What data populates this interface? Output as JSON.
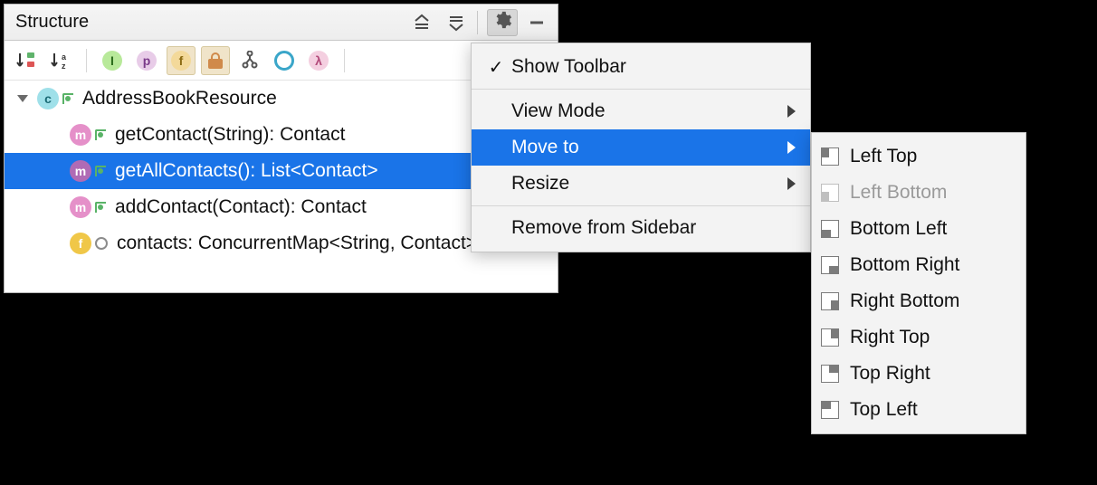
{
  "panel": {
    "title": "Structure",
    "header_buttons": {
      "expand_all": "expand-all",
      "collapse_all": "collapse-all",
      "settings": "settings",
      "hide": "hide"
    }
  },
  "toolbar": {
    "sort_by_visibility": "sort-by-visibility",
    "sort_alphabetically": "sort-alphabetically",
    "show_interfaces": "I",
    "show_properties": "p",
    "show_fields": "f",
    "show_non_public": "lock",
    "show_inherited": "inherited",
    "show_anonymous": "anonymous",
    "show_lambdas": "λ"
  },
  "tree": {
    "class_icon": "c",
    "class_name": "AddressBookResource",
    "members": [
      {
        "icon": "m",
        "iconColor": "#e590c9",
        "vis": "open",
        "text": "getContact(String): Contact",
        "selected": false
      },
      {
        "icon": "m",
        "iconColor": "#b06bb5",
        "vis": "open",
        "text": "getAllContacts(): List<Contact>",
        "selected": true
      },
      {
        "icon": "m",
        "iconColor": "#e590c9",
        "vis": "open",
        "text": "addContact(Contact): Contact",
        "selected": false
      },
      {
        "icon": "f",
        "iconColor": "#f0c748",
        "vis": "pkg",
        "text": "contacts: ConcurrentMap<String, Contact>",
        "selected": false
      }
    ]
  },
  "menu": {
    "items": [
      {
        "label": "Show Toolbar",
        "checked": true,
        "submenu": false,
        "highlight": false
      },
      {
        "label": "View Mode",
        "checked": false,
        "submenu": true,
        "highlight": false
      },
      {
        "label": "Move to",
        "checked": false,
        "submenu": true,
        "highlight": true
      },
      {
        "label": "Resize",
        "checked": false,
        "submenu": true,
        "highlight": false
      },
      {
        "label": "Remove from Sidebar",
        "checked": false,
        "submenu": false,
        "highlight": false
      }
    ]
  },
  "submenu": {
    "items": [
      {
        "label": "Left Top",
        "pos": "lt",
        "disabled": false
      },
      {
        "label": "Left Bottom",
        "pos": "lb",
        "disabled": true
      },
      {
        "label": "Bottom Left",
        "pos": "bl",
        "disabled": false
      },
      {
        "label": "Bottom Right",
        "pos": "br",
        "disabled": false
      },
      {
        "label": "Right Bottom",
        "pos": "rb",
        "disabled": false
      },
      {
        "label": "Right Top",
        "pos": "rt",
        "disabled": false
      },
      {
        "label": "Top Right",
        "pos": "tr",
        "disabled": false
      },
      {
        "label": "Top Left",
        "pos": "tl",
        "disabled": false
      }
    ]
  }
}
